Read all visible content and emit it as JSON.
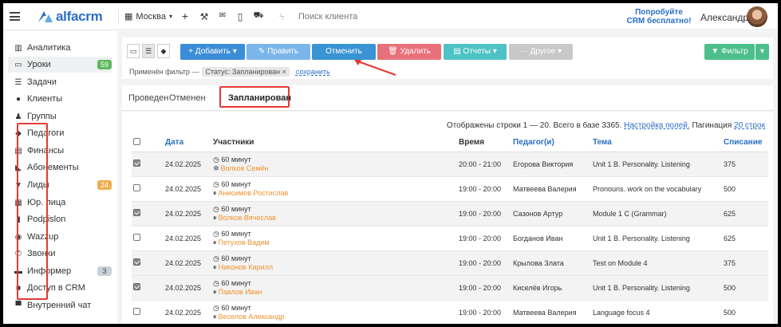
{
  "header": {
    "logo_text": "alfacrm",
    "city": "Москва",
    "search_placeholder": "Поиск клиента",
    "promo_line1": "Попробуйте",
    "promo_line2": "CRM бесплатно!",
    "user_name": "Александра"
  },
  "sidebar": {
    "items": [
      {
        "label": "Аналитика",
        "icon": "chart-icon",
        "glyph": "▥",
        "count": ""
      },
      {
        "label": "Уроки",
        "icon": "calendar-icon",
        "glyph": "▭",
        "count": "59",
        "active": true
      },
      {
        "label": "Задачи",
        "icon": "tasks-icon",
        "glyph": "☰",
        "count": ""
      },
      {
        "label": "Клиенты",
        "icon": "user-icon",
        "glyph": "●",
        "count": ""
      },
      {
        "label": "Группы",
        "icon": "users-icon",
        "glyph": "♟",
        "count": ""
      },
      {
        "label": "Педагоги",
        "icon": "graduation-cap-icon",
        "glyph": "◆",
        "count": ""
      },
      {
        "label": "Финансы",
        "icon": "money-icon",
        "glyph": "▤",
        "count": ""
      },
      {
        "label": "Абонементы",
        "icon": "tag-icon",
        "glyph": "◣",
        "count": ""
      },
      {
        "label": "Лиды",
        "icon": "funnel-icon",
        "glyph": "▼",
        "count": "24"
      },
      {
        "label": "Юр. лица",
        "icon": "building-icon",
        "glyph": "▦",
        "count": ""
      },
      {
        "label": "Podpislon",
        "icon": "document-icon",
        "glyph": "▮",
        "count": ""
      },
      {
        "label": "Wazzup",
        "icon": "whatsapp-icon",
        "glyph": "◉",
        "count": ""
      },
      {
        "label": "Звонки",
        "icon": "phone-icon",
        "glyph": "✆",
        "count": ""
      },
      {
        "label": "Информер",
        "icon": "book-icon",
        "glyph": "▬",
        "count": "3"
      },
      {
        "label": "Доступ в CRM",
        "icon": "lock-icon",
        "glyph": "■",
        "count": ""
      },
      {
        "label": "Внутренний чат",
        "icon": "chat-icon",
        "glyph": "▀",
        "count": ""
      }
    ]
  },
  "toolbar": {
    "add_label": "+ Добавить ▾",
    "edit_label": "✎ Править",
    "cancel_label": "Отменить",
    "delete_label": "🗑 Удалить",
    "reports_label": "▤ Отчеты ▾",
    "other_label": "··· Другое ▾",
    "filter_label": "▼ Фильтр",
    "filter_applied_label": "Применён фильтр —",
    "filter_chip": "Статус: Запланирован",
    "save_label": "сохранить"
  },
  "colors": {
    "add": "#3c8dd8",
    "edit": "#7ab6ea",
    "cancel": "#3a93d3",
    "delete": "#e8707a",
    "reports": "#4ec2c4",
    "other": "#c8c8c8",
    "filter": "#4cbf8c",
    "accent": "#2a6ec4",
    "highlight": "#e53935"
  },
  "tabs": [
    "Проведен",
    "Отменен",
    "Запланирован"
  ],
  "info": {
    "text": "Отображены строки 1 — 20. Всего в базе 3365.",
    "settings_link": "Настройка полей.",
    "pagination_label": "Пагинация",
    "pagination_link": "20 строк"
  },
  "table": {
    "headers": [
      "Дата",
      "Участники",
      "Время",
      "Педагог(и)",
      "Тема",
      "Списание"
    ],
    "rows": [
      {
        "checked": true,
        "date": "24.02.2025",
        "duration": "60 минут",
        "student": "Волков Семён",
        "sym": "✲",
        "time": "20:00 - 21:00",
        "teacher": "Егорова Виктория",
        "topic": "Unit 1 B. Personality. Listening",
        "charge": "375"
      },
      {
        "checked": false,
        "date": "24.02.2025",
        "duration": "60 минут",
        "student": "Анисимов Ростислав",
        "sym": "⏸",
        "time": "19:00 - 20:00",
        "teacher": "Матвеева Валерия",
        "topic": "Pronouns. work on the vocabulary",
        "charge": "500"
      },
      {
        "checked": true,
        "date": "24.02.2025",
        "duration": "60 минут",
        "student": "Волков Вячеслав",
        "sym": "⏸",
        "time": "19:00 - 20:00",
        "teacher": "Сазонов Артур",
        "topic": "Module 1 C (Grammar)",
        "charge": "625"
      },
      {
        "checked": false,
        "date": "24.02.2025",
        "duration": "60 минут",
        "student": "Петухов Вадим",
        "sym": "⏸",
        "time": "19:00 - 20:00",
        "teacher": "Богданов Иван",
        "topic": "Unit 1 B. Personality. Listening",
        "charge": "625"
      },
      {
        "checked": true,
        "date": "24.02.2025",
        "duration": "60 минут",
        "student": "Никонов Кирилл",
        "sym": "⏸",
        "time": "19:00 - 20:00",
        "teacher": "Крылова Злата",
        "topic": "Test on Module 4",
        "charge": "375"
      },
      {
        "checked": true,
        "date": "24.02.2025",
        "duration": "60 минут",
        "student": "Павлов Иван",
        "sym": "⏸",
        "time": "19:00 - 20:00",
        "teacher": "Киселёв Игорь",
        "topic": "Unit 1 B. Personality. Listening",
        "charge": "500"
      },
      {
        "checked": false,
        "date": "24.02.2025",
        "duration": "60 минут",
        "student": "Веселов Александр",
        "sym": "⏸",
        "time": "19:00 - 20:00",
        "teacher": "Матвеева Валерия",
        "topic": "Language focus 4",
        "charge": "500"
      }
    ]
  }
}
